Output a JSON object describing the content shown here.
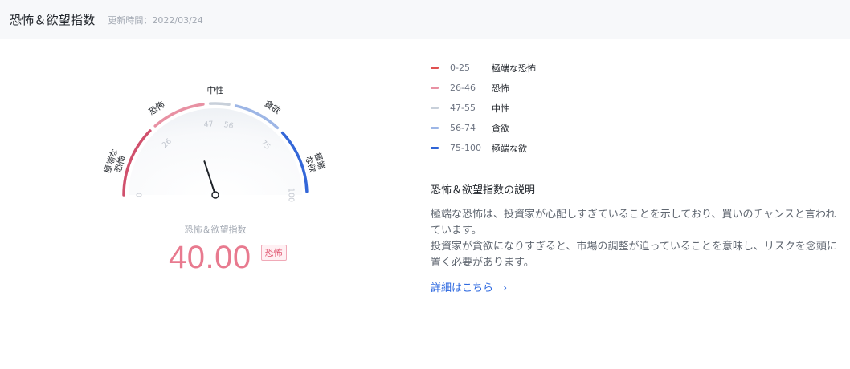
{
  "header": {
    "title": "恐怖＆欲望指数",
    "updated": "更新時間：2022/03/24"
  },
  "gauge": {
    "value": 40,
    "min": 0,
    "max": 100,
    "caption": "恐怖＆欲望指数",
    "value_display": "40.00",
    "status_badge": "恐怖",
    "ticks": [
      "0",
      "26",
      "47",
      "56",
      "75",
      "100"
    ],
    "zones": [
      {
        "from": 0,
        "to": 25,
        "label": "極端な恐怖",
        "color": "#d0506c"
      },
      {
        "from": 26,
        "to": 46,
        "label": "恐怖",
        "color": "#e891a3"
      },
      {
        "from": 47,
        "to": 55,
        "label": "中性",
        "color": "#c8d0da"
      },
      {
        "from": 56,
        "to": 74,
        "label": "貪欲",
        "color": "#9db6e6"
      },
      {
        "from": 75,
        "to": 100,
        "label": "極端な欲",
        "color": "#3467d8"
      }
    ],
    "outer_labels": [
      "極端な\n恐怖",
      "恐怖",
      "中性",
      "貪欲",
      "極端\nな欲"
    ]
  },
  "legend": [
    {
      "range": "0-25",
      "label": "極端な恐怖",
      "color": "#e05050"
    },
    {
      "range": "26-46",
      "label": "恐怖",
      "color": "#e891a3"
    },
    {
      "range": "47-55",
      "label": "中性",
      "color": "#c8d0da"
    },
    {
      "range": "56-74",
      "label": "貪欲",
      "color": "#9db6e6"
    },
    {
      "range": "75-100",
      "label": "極端な欲",
      "color": "#2f64d6"
    }
  ],
  "description": {
    "title": "恐怖＆欲望指数の説明",
    "paragraph1": "極端な恐怖は、投資家が心配しすぎていることを示しており、買いのチャンスと言われています。",
    "paragraph2": "投資家が貪欲になりすぎると、市場の調整が迫っていることを意味し、リスクを念頭に置く必要があります。"
  },
  "link": {
    "label": "詳細はこちら",
    "chevron": "›"
  }
}
